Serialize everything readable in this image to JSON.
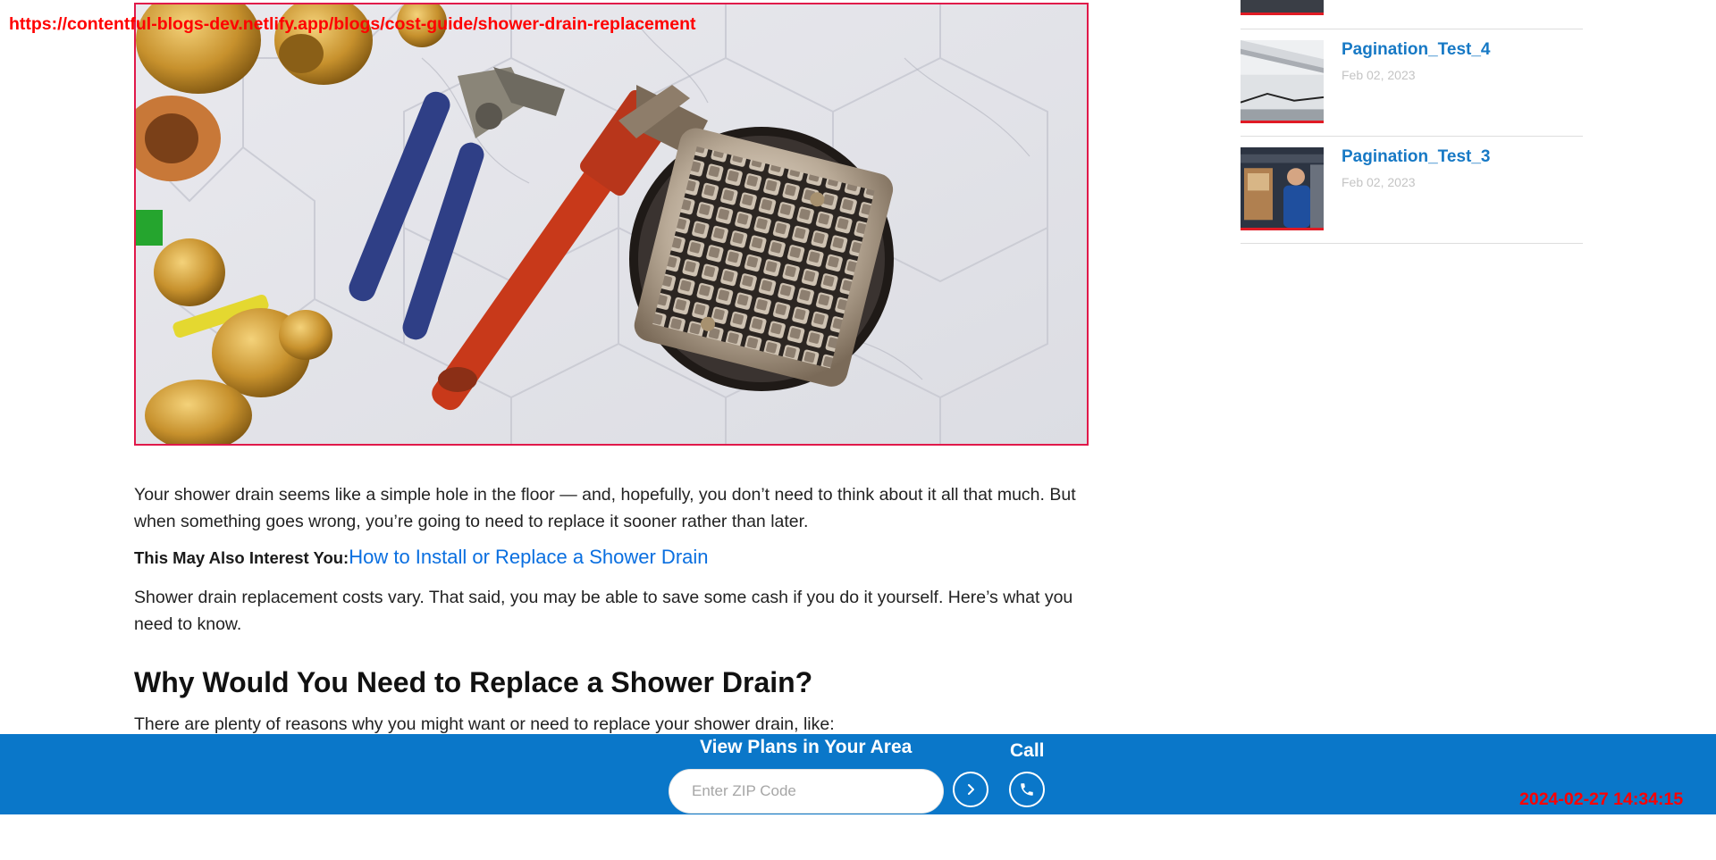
{
  "article": {
    "hero_image_alt": "shower-drain-and-plumbing-tools",
    "intro_paragraph": "Your shower drain seems like a simple hole in the floor — and, hopefully, you don’t need to think about it all that much. But when something goes wrong, you’re going to need to replace it sooner rather than later.",
    "interest_label": "This May Also Interest You:",
    "interest_link": "How to Install or Replace a Shower Drain",
    "cost_paragraph": "Shower drain replacement costs vary. That said, you may be able to save some cash if you do it yourself. Here’s what you need to know.",
    "section_heading": "Why Would You Need to Replace a Shower Drain?",
    "section_paragraph": "There are plenty of reasons why you might want or need to replace your shower drain, like:"
  },
  "sidebar": {
    "items": [
      {
        "title": "Pagination_Test_4",
        "date": "Feb 02, 2023"
      },
      {
        "title": "Pagination_Test_3",
        "date": "Feb 02, 2023"
      }
    ]
  },
  "bottom_bar": {
    "title": "View Plans in Your Area",
    "zip_placeholder": "Enter ZIP Code",
    "zip_value": "",
    "call_label": "Call",
    "go_icon": "chevron-right-icon",
    "call_icon": "phone-icon",
    "background_color": "#0a77c9"
  },
  "overlay": {
    "url": "https://contentful-blogs-dev.netlify.app/blogs/cost-guide/shower-drain-replacement",
    "timestamp": "2024-02-27 14:34:15"
  },
  "colors": {
    "link": "#0a6fe0",
    "sidebar_title": "#1779c5",
    "accent_red": "#e01b24",
    "overlay_red": "#ff0000"
  }
}
